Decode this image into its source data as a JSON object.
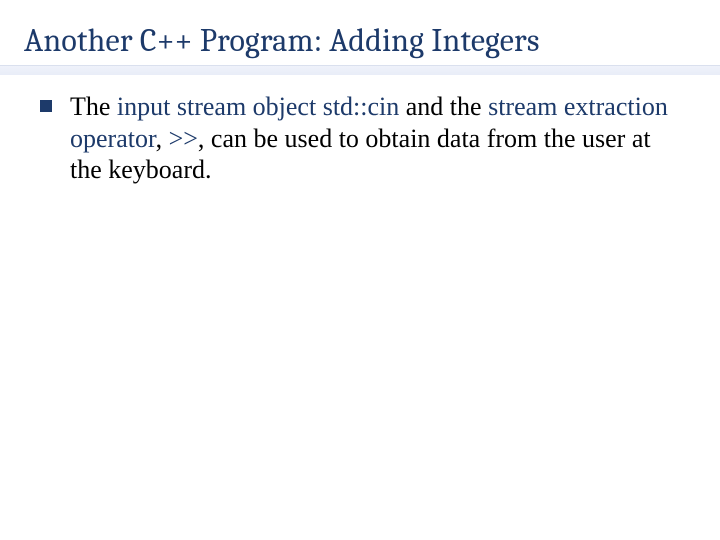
{
  "title": "Another C++ Program: Adding Integers",
  "bullets": [
    {
      "segments": [
        {
          "text": "The ",
          "kw": false
        },
        {
          "text": "input stream object",
          "kw": true
        },
        {
          "text": " ",
          "kw": false
        },
        {
          "text": "std::cin",
          "kw": true
        },
        {
          "text": " and the ",
          "kw": false
        },
        {
          "text": "stream extraction operator",
          "kw": true
        },
        {
          "text": ", ",
          "kw": false
        },
        {
          "text": ">>",
          "kw": true
        },
        {
          "text": ", can be used to obtain data from the user at the keyboard.",
          "kw": false
        }
      ]
    }
  ]
}
